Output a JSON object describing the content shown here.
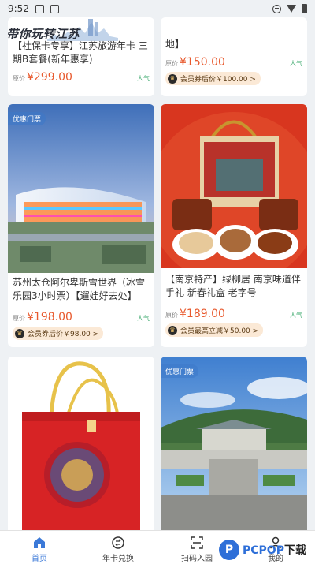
{
  "status_bar": {
    "time": "9:52"
  },
  "brand": {
    "title": "带你玩转江苏"
  },
  "cards": [
    {
      "title": "【社保卡专享】江苏旅游年卡 三期B套餐(新年惠享)",
      "price_prefix": "原价",
      "price": "¥299.00",
      "popularity": "人气",
      "member_text": ""
    },
    {
      "title": "地】",
      "price_prefix": "原价",
      "price": "¥150.00",
      "popularity": "人气",
      "member_text": "会员券后价￥100.00 >"
    },
    {
      "badge": "优惠门票",
      "title": "苏州太仓阿尔卑斯雪世界（冰雪乐园3小时票）【遛娃好去处】",
      "price_prefix": "原价",
      "price": "¥198.00",
      "popularity": "人气",
      "member_text": "会员券后价￥98.00 >"
    },
    {
      "title": "【南京特产】绿柳居 南京味道伴手礼 新春礼盒 老字号",
      "price_prefix": "原价",
      "price": "¥189.00",
      "popularity": "人气",
      "member_text": "会员最高立减￥50.00 >"
    },
    {
      "title": ""
    },
    {
      "badge": "优惠门票",
      "title": ""
    }
  ],
  "bottom_nav": {
    "items": [
      {
        "label": "首页",
        "icon": "home-icon",
        "active": true
      },
      {
        "label": "年卡兑换",
        "icon": "exchange-icon",
        "active": false
      },
      {
        "label": "扫码入园",
        "icon": "scan-icon",
        "active": false
      },
      {
        "label": "我的",
        "icon": "user-icon",
        "active": false
      }
    ]
  },
  "watermark": {
    "logo": "P",
    "text_main": "PCPOP",
    "text_suffix": "下载"
  },
  "colors": {
    "accent": "#3b79d8",
    "price": "#e8592d",
    "popularity": "#3aa86b",
    "member_bg": "#fbe9d6"
  }
}
